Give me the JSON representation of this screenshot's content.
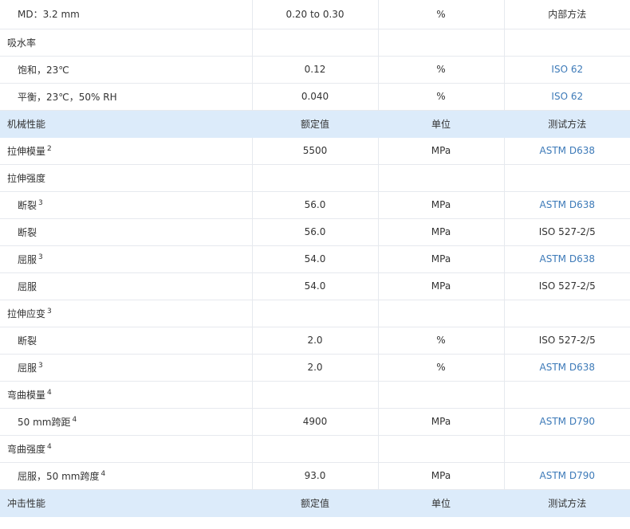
{
  "rows": [
    {
      "type": "data",
      "label": "MD：3.2 mm",
      "sup": "",
      "indent": true,
      "value": "0.20 to 0.30",
      "unit": "%",
      "method": "内部方法",
      "link": false
    },
    {
      "type": "group",
      "label": "吸水率",
      "sup": ""
    },
    {
      "type": "data",
      "label": "饱和，23℃",
      "sup": "",
      "indent": true,
      "value": "0.12",
      "unit": "%",
      "method": "ISO 62",
      "link": true
    },
    {
      "type": "data",
      "label": "平衡，23℃，50% RH",
      "sup": "",
      "indent": true,
      "value": "0.040",
      "unit": "%",
      "method": "ISO 62",
      "link": true
    },
    {
      "type": "section",
      "label": "机械性能",
      "value": "额定值",
      "unit": "单位",
      "method": "测试方法"
    },
    {
      "type": "data",
      "label": "拉伸模量",
      "sup": "2",
      "indent": false,
      "value": "5500",
      "unit": "MPa",
      "method": "ASTM D638",
      "link": true
    },
    {
      "type": "group",
      "label": "拉伸强度",
      "sup": ""
    },
    {
      "type": "data",
      "label": "断裂",
      "sup": "3",
      "indent": true,
      "value": "56.0",
      "unit": "MPa",
      "method": "ASTM D638",
      "link": true
    },
    {
      "type": "data",
      "label": "断裂",
      "sup": "",
      "indent": true,
      "value": "56.0",
      "unit": "MPa",
      "method": "ISO 527-2/5",
      "link": false
    },
    {
      "type": "data",
      "label": "屈服",
      "sup": "3",
      "indent": true,
      "value": "54.0",
      "unit": "MPa",
      "method": "ASTM D638",
      "link": true
    },
    {
      "type": "data",
      "label": "屈服",
      "sup": "",
      "indent": true,
      "value": "54.0",
      "unit": "MPa",
      "method": "ISO 527-2/5",
      "link": false
    },
    {
      "type": "group",
      "label": "拉伸应变",
      "sup": "3"
    },
    {
      "type": "data",
      "label": "断裂",
      "sup": "",
      "indent": true,
      "value": "2.0",
      "unit": "%",
      "method": "ISO 527-2/5",
      "link": false
    },
    {
      "type": "data",
      "label": "屈服",
      "sup": "3",
      "indent": true,
      "value": "2.0",
      "unit": "%",
      "method": "ASTM D638",
      "link": true
    },
    {
      "type": "group",
      "label": "弯曲模量",
      "sup": "4"
    },
    {
      "type": "data",
      "label": "50 mm跨距",
      "sup": "4",
      "indent": true,
      "value": "4900",
      "unit": "MPa",
      "method": "ASTM D790",
      "link": true
    },
    {
      "type": "group",
      "label": "弯曲强度",
      "sup": "4"
    },
    {
      "type": "data",
      "label": "屈服，50 mm跨度",
      "sup": "4",
      "indent": true,
      "value": "93.0",
      "unit": "MPa",
      "method": "ASTM D790",
      "link": true
    },
    {
      "type": "section",
      "label": "冲击性能",
      "value": "额定值",
      "unit": "单位",
      "method": "测试方法"
    }
  ],
  "colors": {
    "section_bg": "#dcebfa",
    "link": "#3d7ab8",
    "text": "#333333",
    "border": "#e6e9ee"
  }
}
